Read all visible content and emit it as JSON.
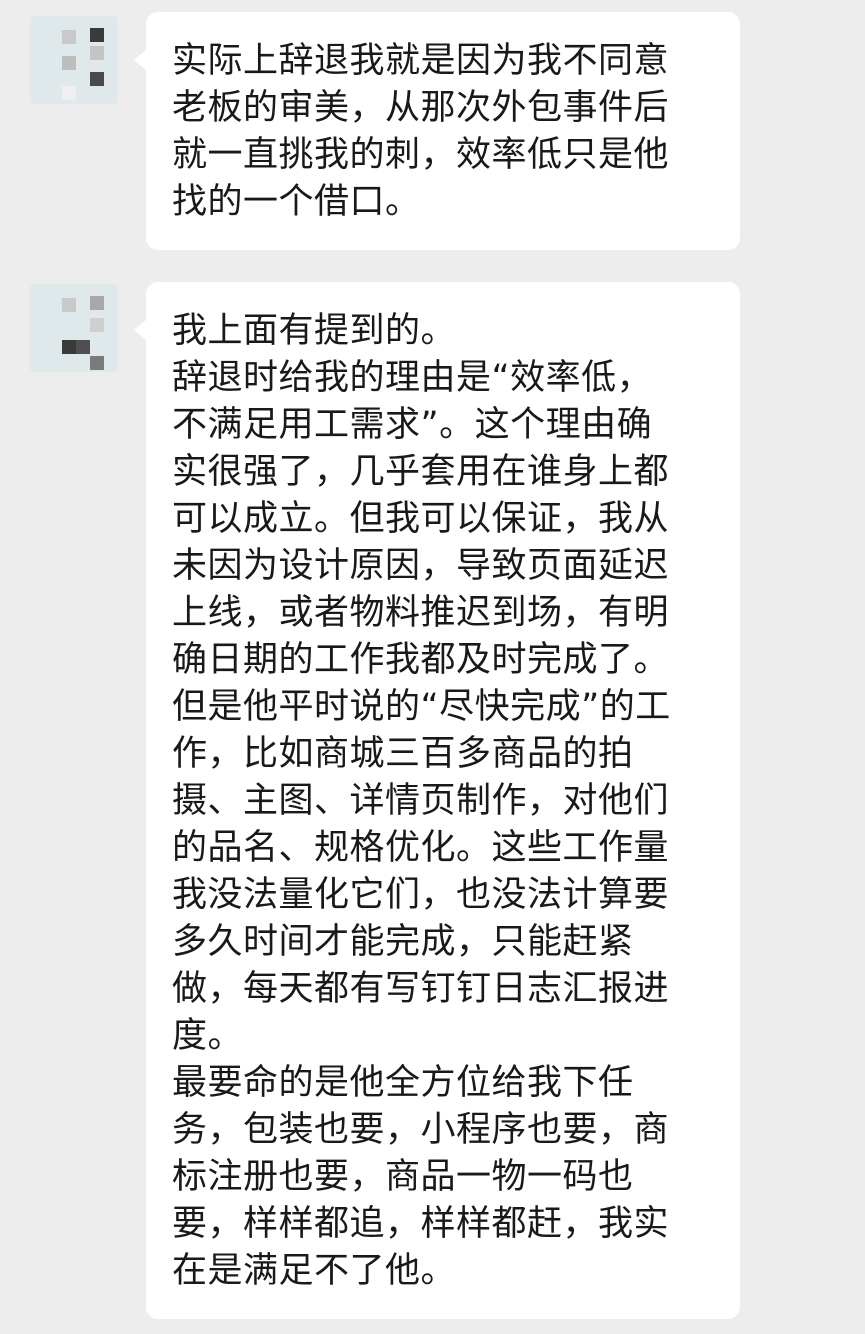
{
  "messages": [
    {
      "sender": "other",
      "lines": [
        "实际上辞退我就是因为我不同意",
        "老板的审美，从那次外包事件后",
        "就一直挑我的刺，效率低只是他",
        "找的一个借口。"
      ]
    },
    {
      "sender": "other",
      "lines": [
        "我上面有提到的。",
        "辞退时给我的理由是“效率低，",
        "不满足用工需求”。这个理由确",
        "实很强了，几乎套用在谁身上都",
        "可以成立。但我可以保证，我从",
        "未因为设计原因，导致页面延迟",
        "上线，或者物料推迟到场，有明",
        "确日期的工作我都及时完成了。",
        "但是他平时说的“尽快完成”的工",
        "作，比如商城三百多商品的拍",
        "摄、主图、详情页制作，对他们",
        "的品名、规格优化。这些工作量",
        "我没法量化它们，也没法计算要",
        "多久时间才能完成，只能赶紧",
        "做，每天都有写钉钉日志汇报进",
        "度。",
        "最要命的是他全方位给我下任",
        "务，包装也要，小程序也要，商",
        "标注册也要，商品一物一码也",
        "要，样样都追，样样都赶，我实",
        "在是满足不了他。"
      ]
    }
  ]
}
